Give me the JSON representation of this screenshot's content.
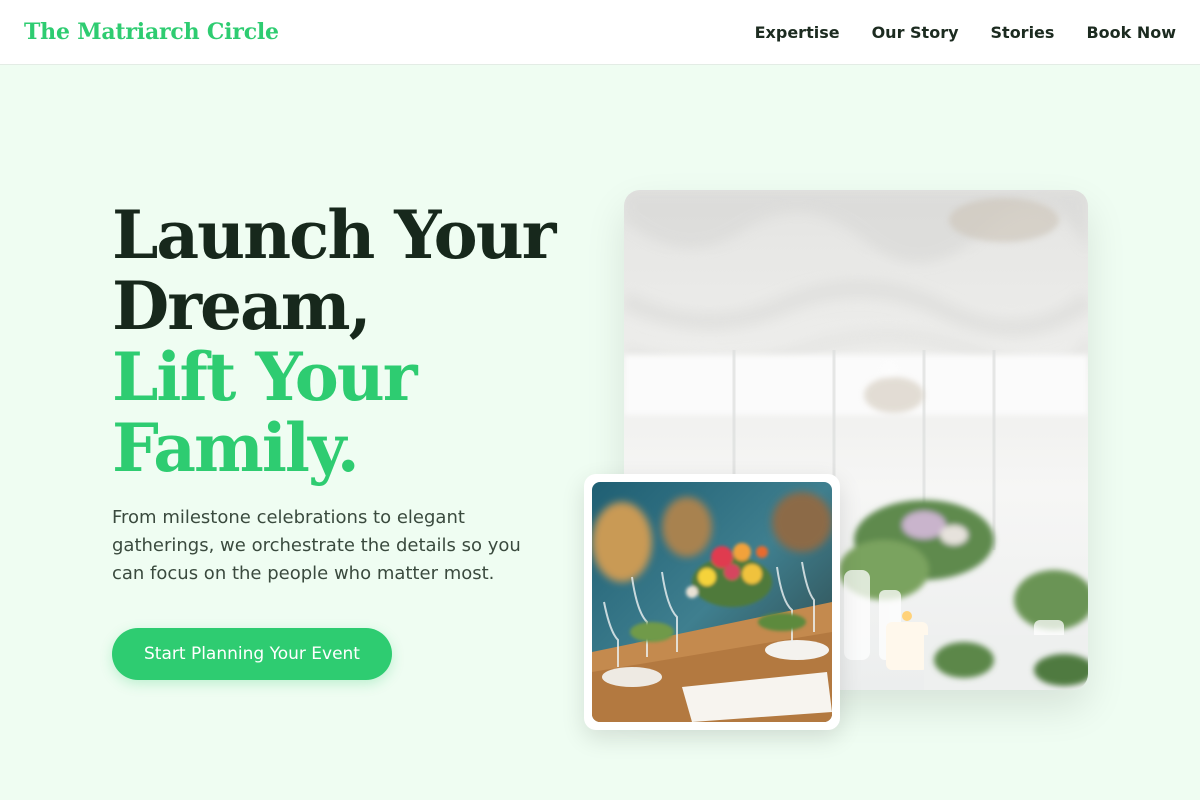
{
  "header": {
    "brand": "The Matriarch Circle",
    "nav": [
      "Expertise",
      "Our Story",
      "Stories",
      "Book Now"
    ]
  },
  "hero": {
    "headline_line1": "Launch Your",
    "headline_line2": "Dream,",
    "headline_accent1": "Lift Your",
    "headline_accent2": "Family.",
    "subtext": "From milestone celebrations to elegant gatherings, we orchestrate the details so you can focus on the people who matter most.",
    "cta_label": "Start Planning Your Event"
  },
  "colors": {
    "accent": "#2ecc71",
    "page_background": "#effdf2",
    "headline_dark": "#17281c"
  },
  "images": {
    "main": "event-tent-photo",
    "inset": "table-setting-photo"
  }
}
